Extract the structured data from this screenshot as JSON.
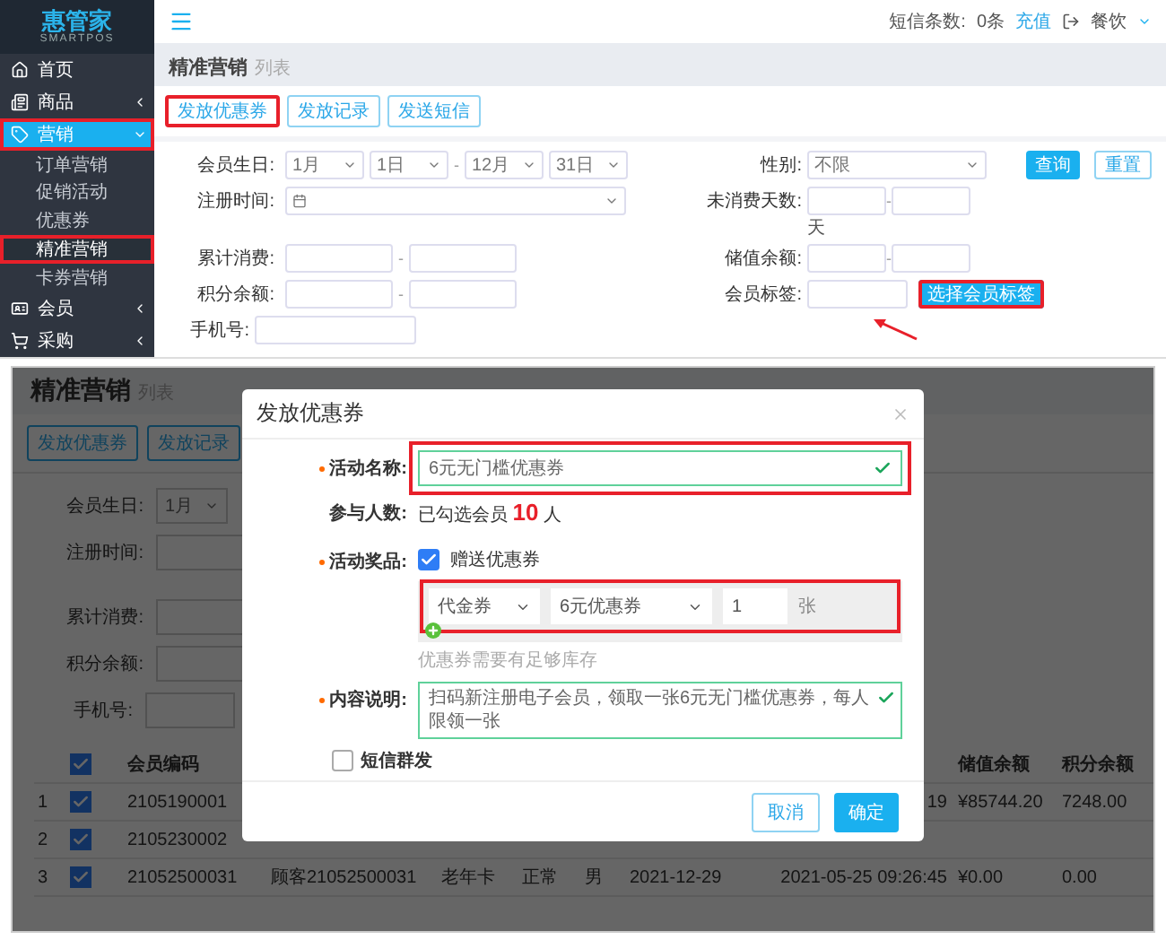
{
  "top": {
    "logo": {
      "name": "惠管家",
      "tagline": "SMARTPOS"
    },
    "sidebar": [
      {
        "label": "首页",
        "arrow": false,
        "expanded": false,
        "selected": false,
        "highlighted": false
      },
      {
        "label": "商品",
        "arrow": true,
        "expanded": false,
        "selected": false,
        "highlighted": false
      },
      {
        "label": "营销",
        "arrow": true,
        "expanded": true,
        "selected": true,
        "highlighted": true,
        "children": [
          {
            "label": "订单营销",
            "selected": false,
            "highlighted": false
          },
          {
            "label": "促销活动",
            "selected": false,
            "highlighted": false
          },
          {
            "label": "优惠券",
            "selected": false,
            "highlighted": false
          },
          {
            "label": "精准营销",
            "selected": true,
            "highlighted": true
          },
          {
            "label": "卡券营销",
            "selected": false,
            "highlighted": false
          }
        ]
      },
      {
        "label": "会员",
        "arrow": true,
        "expanded": false,
        "selected": false,
        "highlighted": false
      },
      {
        "label": "采购",
        "arrow": true,
        "expanded": false,
        "selected": false,
        "highlighted": false
      }
    ],
    "header": {
      "sms_label": "短信条数:",
      "sms_count": "0条",
      "recharge": "充值",
      "store": "餐饮"
    },
    "page_title": "精准营销",
    "page_subtitle": "列表",
    "tabs": [
      {
        "label": "发放优惠券",
        "highlighted": true
      },
      {
        "label": "发放记录",
        "highlighted": false
      },
      {
        "label": "发送短信",
        "highlighted": false
      }
    ],
    "filters": {
      "birthday": {
        "label": "会员生日:",
        "from_month": "1月",
        "from_day": "1日",
        "to_month": "12月",
        "to_day": "31日"
      },
      "gender": {
        "label": "性别:",
        "value": "不限"
      },
      "register": {
        "label": "注册时间:"
      },
      "idle_days": {
        "label": "未消费天数:",
        "unit": "天"
      },
      "spent": {
        "label": "累计消费:"
      },
      "stored": {
        "label": "储值余额:"
      },
      "points": {
        "label": "积分余额:"
      },
      "tags": {
        "label": "会员标签:",
        "button": "选择会员标签",
        "highlighted": true
      },
      "phone": {
        "label": "手机号:"
      },
      "separator": "-"
    },
    "search_button": "查询",
    "reset_button": "重置"
  },
  "bottom": {
    "page_title": "精准营销",
    "page_subtitle": "列表",
    "tabs": [
      "发放优惠券",
      "发放记录"
    ],
    "filters": [
      {
        "label": "会员生日:",
        "value": "1月"
      },
      {
        "label": "注册时间:"
      },
      {
        "label": "累计消费:"
      },
      {
        "label": "积分余额:"
      },
      {
        "label": "手机号:"
      }
    ],
    "table": {
      "header_checked": true,
      "columns": {
        "code": "会员编码",
        "stored": "储值余额",
        "points": "积分余额"
      },
      "rows": [
        {
          "number": "1",
          "checked": true,
          "code": "2105190001",
          "time": "19",
          "stored": "¥85744.20",
          "points": "7248.00"
        },
        {
          "number": "2",
          "checked": true,
          "code": "2105230002"
        },
        {
          "number": "3",
          "checked": true,
          "code": "21052500031",
          "name": "顾客21052500031",
          "card": "老年卡",
          "status": "正常",
          "gender": "男",
          "date": "2021-12-29",
          "time": "2021-05-25 09:26:45",
          "stored": "¥0.00",
          "points": "0.00"
        }
      ]
    },
    "modal": {
      "title": "发放优惠券",
      "name": {
        "label": "活动名称:",
        "required": true,
        "value": "6元无门槛优惠券",
        "valid": true,
        "highlighted": true
      },
      "count": {
        "label": "参与人数:",
        "prefix": "已勾选会员",
        "number": "10",
        "suffix": "人"
      },
      "prize": {
        "label": "活动奖品:",
        "required": true,
        "checkbox_label": "赠送优惠券",
        "checked": true,
        "type": "代金券",
        "coupon": "6元优惠券",
        "quantity": "1",
        "unit": "张",
        "hint": "优惠券需要有足够库存",
        "highlighted": true
      },
      "content": {
        "label": "内容说明:",
        "required": true,
        "value": "扫码新注册电子会员，领取一张6元无门槛优惠券，每人限领一张",
        "valid": true
      },
      "sms": {
        "label": "短信群发",
        "checked": false
      },
      "cancel": "取消",
      "confirm": "确定"
    }
  }
}
